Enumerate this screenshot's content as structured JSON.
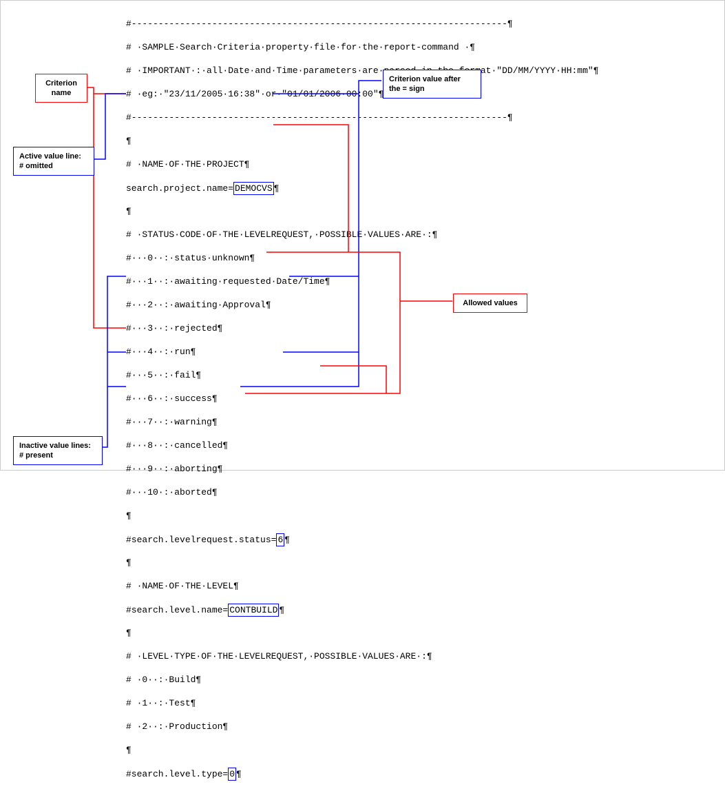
{
  "callouts": {
    "criterion_name": "Criterion\nname",
    "active_value": "Active value line:\n# omitted",
    "inactive_value": "Inactive value lines:\n# present",
    "criterion_value": "Criterion value after\nthe = sign",
    "allowed_values": "Allowed values"
  },
  "lines": {
    "l1": "#----------------------------------------------------------------------¶",
    "l2": "# ·SAMPLE·Search·Criteria·property·file·for·the·report-command ·¶",
    "l3": "# ·IMPORTANT·:·all·Date·and·Time·parameters·are·parsed·in·the·format·\"DD/MM/YYYY·HH:mm\"¶",
    "l4": "# ·eg:·\"23/11/2005·16:38\"·or·\"01/01/2006·00:00\"¶",
    "l5": "#----------------------------------------------------------------------¶",
    "l6": "¶",
    "l7": "# ·NAME·OF·THE·PROJECT¶",
    "l8a": "search.project.name=",
    "l8b": "DEMOCVS",
    "l8c": "¶",
    "l9": "¶",
    "l10": "# ·STATUS·CODE·OF·THE·LEVELREQUEST,·POSSIBLE·VALUES·ARE·:¶",
    "l11": "#···0··:·status·unknown¶",
    "l12": "#···1··:·awaiting·requested·Date/Time¶",
    "l13": "#···2··:·awaiting·Approval¶",
    "l14": "#···3··:·rejected¶",
    "l15": "#···4··:·run¶",
    "l16": "#···5··:·fail¶",
    "l17": "#···6··:·success¶",
    "l18": "#···7··:·warning¶",
    "l19": "#···8··:·cancelled¶",
    "l20": "#···9··:·aborting¶",
    "l21": "#···10·:·aborted¶",
    "l22": "¶",
    "l23a": "#search.levelrequest.status=",
    "l23b": "6",
    "l23c": "¶",
    "l24": "¶",
    "l25": "# ·NAME·OF·THE·LEVEL¶",
    "l26a": "#search.level.name=",
    "l26b": "CONTBUILD",
    "l26c": "¶",
    "l27": "¶",
    "l28": "# ·LEVEL·TYPE·OF·THE·LEVELREQUEST,·POSSIBLE·VALUES·ARE·:¶",
    "l29": "# ·0··:·Build¶",
    "l30": "# ·1··:·Test¶",
    "l31": "# ·2··:·Production¶",
    "l32": "¶",
    "l33a": "#search.level.type=",
    "l33b": "0",
    "l33c": "¶"
  }
}
